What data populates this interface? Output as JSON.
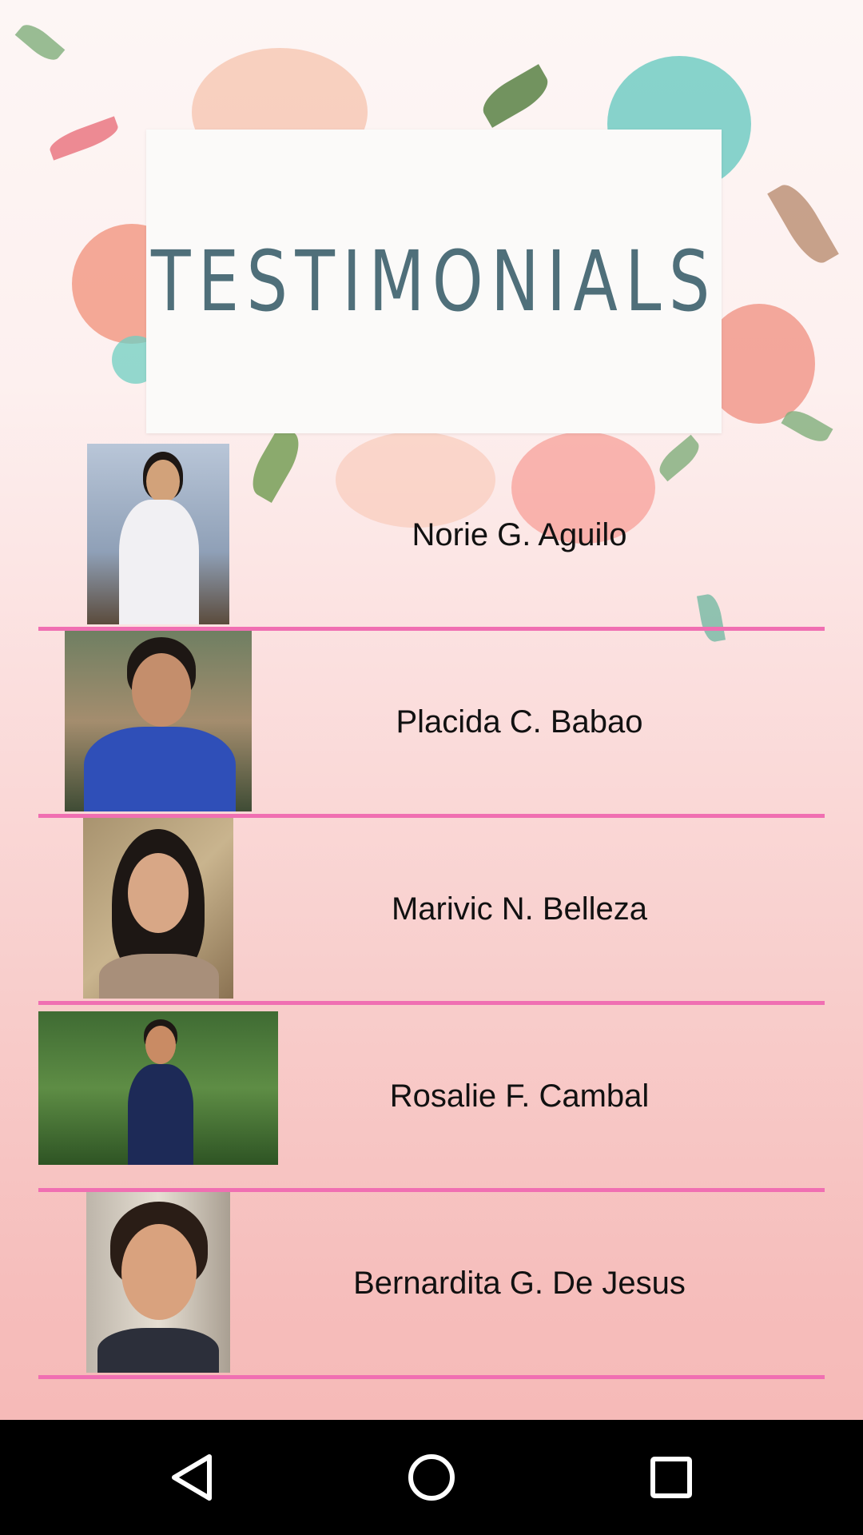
{
  "header": {
    "title": "TESTIMONIALS"
  },
  "testimonials": [
    {
      "name": "Norie G. Aguilo",
      "photo": "photo-norie"
    },
    {
      "name": "Placida C. Babao",
      "photo": "photo-placida"
    },
    {
      "name": "Marivic N. Belleza",
      "photo": "photo-marivic"
    },
    {
      "name": "Rosalie F. Cambal",
      "photo": "photo-rosalie"
    },
    {
      "name": "Bernardita G. De Jesus",
      "photo": "photo-bernardita"
    }
  ],
  "navbar": {
    "back_icon": "back-triangle-icon",
    "home_icon": "home-circle-icon",
    "recents_icon": "recents-square-icon"
  },
  "colors": {
    "divider": "#f06fb2",
    "title": "#4f6f7a",
    "navbar": "#000000"
  }
}
